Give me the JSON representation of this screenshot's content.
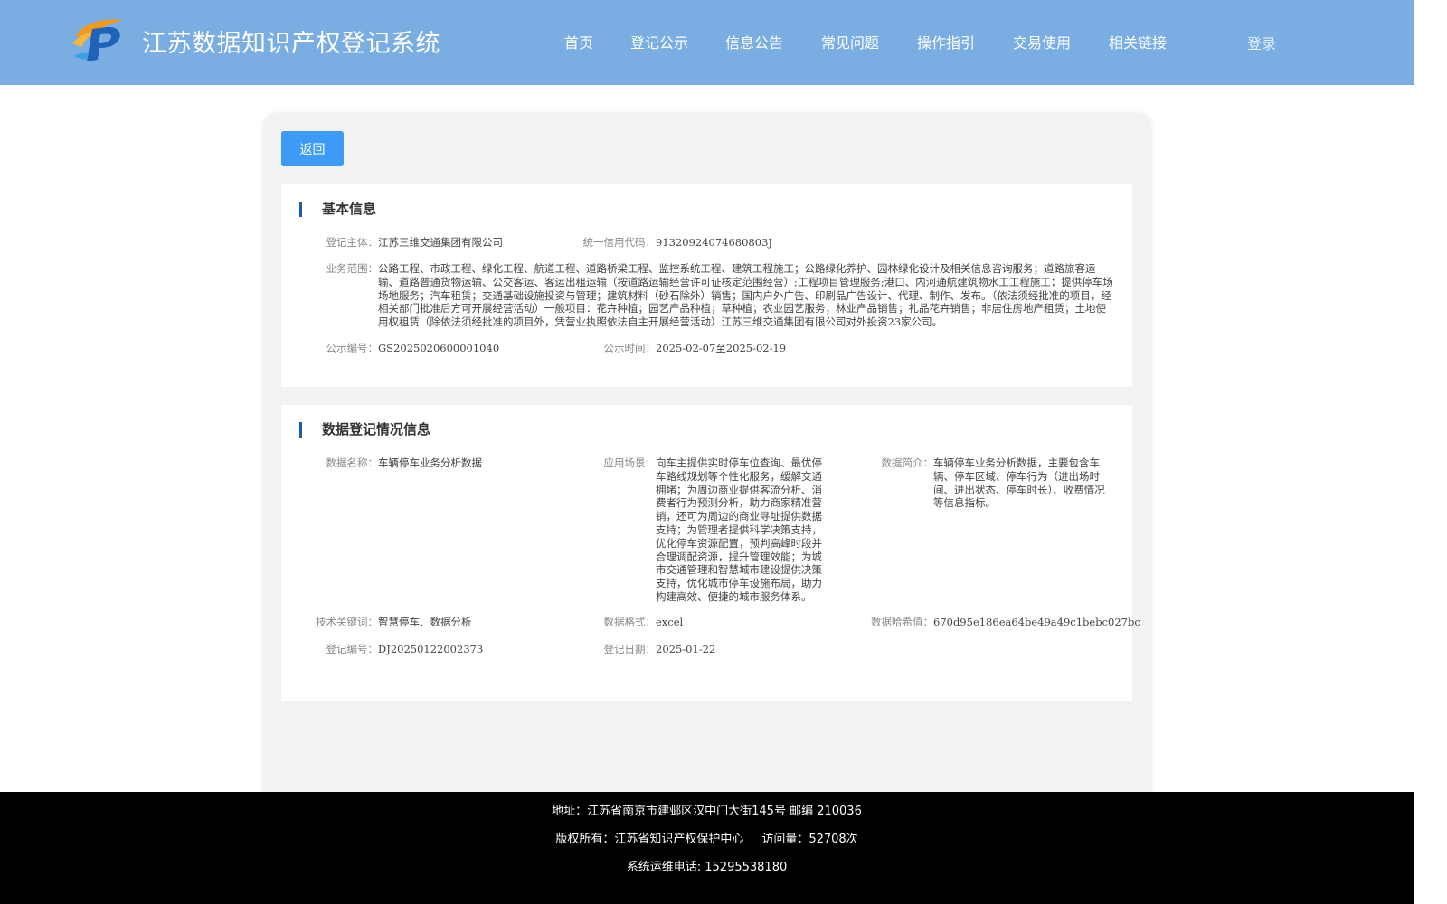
{
  "header": {
    "site_title": "江苏数据知识产权登记系统",
    "login_label": "登录",
    "nav": [
      "首页",
      "登记公示",
      "信息公告",
      "常见问题",
      "操作指引",
      "交易使用",
      "相关链接"
    ]
  },
  "panel": {
    "back_label": "返回",
    "basic": {
      "title": "基本信息",
      "subject_label": "登记主体：",
      "subject_value": "江苏三维交通集团有限公司",
      "credit_label": "统一信用代码：",
      "credit_value": "91320924074680803J",
      "scope_label": "业务范围：",
      "scope_value": "公路工程、市政工程、绿化工程、航道工程、道路桥梁工程、监控系统工程、建筑工程施工；公路绿化养护、园林绿化设计及相关信息咨询服务；道路旅客运输、道路普通货物运输、公交客运、客运出租运输（按道路运输经营许可证核定范围经营）;工程项目管理服务;港口、内河通航建筑物水工工程施工；提供停车场场地服务；汽车租赁；交通基础设施投资与管理；建筑材料（砂石除外）销售；国内户外广告、印刷品广告设计、代理、制作、发布。（依法须经批准的项目，经相关部门批准后方可开展经营活动）一般项目：花卉种植；园艺产品种植；草种植；农业园艺服务；林业产品销售；礼品花卉销售；非居住房地产租赁；土地使用权租赁（除依法须经批准的项目外，凭营业执照依法自主开展经营活动）江苏三维交通集团有限公司对外投资23家公司。",
      "pub_no_label": "公示编号：",
      "pub_no_value": "GS2025020600001040",
      "pub_time_label": "公示时间：",
      "pub_time_value": "2025-02-07至2025-02-19"
    },
    "data": {
      "title": "数据登记情况信息",
      "name_label": "数据名称：",
      "name_value": "车辆停车业务分析数据",
      "scene_label": "应用场景：",
      "scene_value": "向车主提供实时停车位查询、最优停车路线规划等个性化服务，缓解交通拥堵；为周边商业提供客流分析、消费者行为预测分析，助力商家精准营销，还可为周边的商业寻址提供数据支持；为管理者提供科学决策支持，优化停车资源配置，预判高峰时段并合理调配资源，提升管理效能；为城市交通管理和智慧城市建设提供决策支持，优化城市停车设施布局，助力构建高效、便捷的城市服务体系。",
      "intro_label": "数据简介：",
      "intro_value": "车辆停车业务分析数据，主要包含车辆、停车区域、停车行为（进出场时间、进出状态、停车时长）、收费情况等信息指标。",
      "keyword_label": "技术关键词：",
      "keyword_value": "智慧停车、数据分析",
      "format_label": "数据格式：",
      "format_value": "excel",
      "hash_label": "数据哈希值：",
      "hash_value": "670d95e186ea64be49a49c1bebc027bc",
      "reg_no_label": "登记编号：",
      "reg_no_value": "DJ20250122002373",
      "reg_date_label": "登记日期：",
      "reg_date_value": "2025-01-22"
    }
  },
  "footer": {
    "address": "地址：江苏省南京市建邺区汉中门大街145号 邮编 210036",
    "copyright": "版权所有：江苏省知识产权保护中心",
    "visits": "访问量：52708次",
    "phone": "系统运维电话: 15295538180"
  },
  "colors": {
    "header_bg": "#7aaee3",
    "button_bg": "#3d9bf5",
    "title_bar": "#1f5c9e",
    "footer_bg": "#000000"
  }
}
